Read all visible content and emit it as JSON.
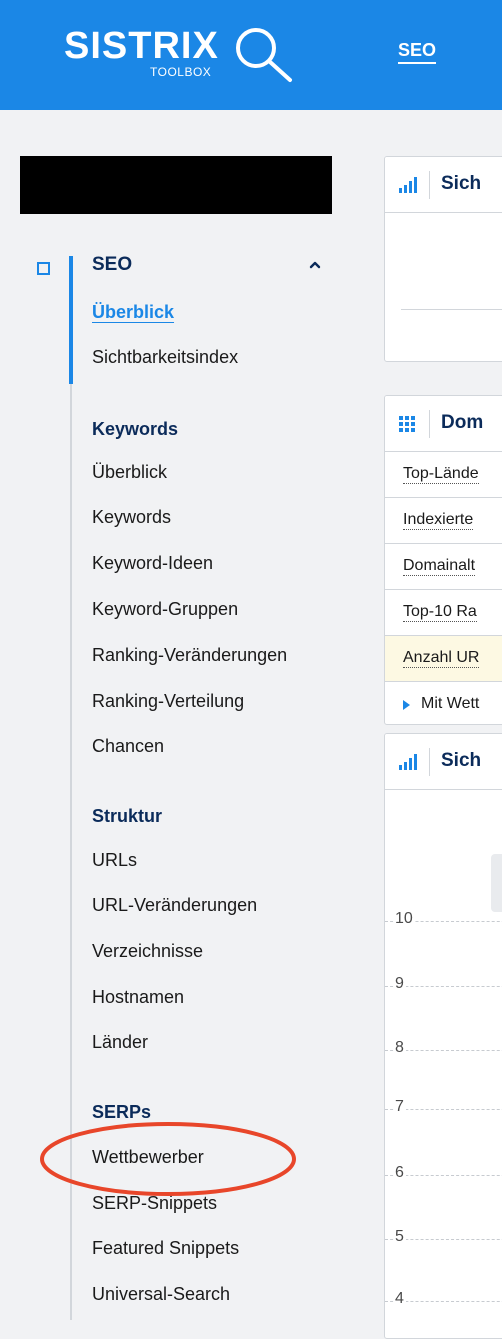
{
  "header": {
    "logo_text": "SISTRIX",
    "logo_sub": "TOOLBOX",
    "nav_seo": "SEO",
    "brand_color": "#1b87e6"
  },
  "sidebar": {
    "seo_title": "SEO",
    "seo_items": [
      "Überblick",
      "Sichtbarkeitsindex"
    ],
    "keywords_title": "Keywords",
    "keywords_items": [
      "Überblick",
      "Keywords",
      "Keyword-Ideen",
      "Keyword-Gruppen",
      "Ranking-Veränderungen",
      "Ranking-Verteilung",
      "Chancen"
    ],
    "struktur_title": "Struktur",
    "struktur_items": [
      "URLs",
      "URL-Veränderungen",
      "Verzeichnisse",
      "Hostnamen",
      "Länder"
    ],
    "serps_title": "SERPs",
    "serps_items": [
      "Wettbewerber",
      "SERP-Snippets",
      "Featured Snippets",
      "Universal-Search"
    ],
    "highlight_color": "#e8462a"
  },
  "main": {
    "panel1_title": "Sich",
    "panel2_title": "Dom",
    "panel2_rows": [
      "Top-Lände",
      "Indexierte",
      "Domainalt",
      "Top-10 Ra",
      "Anzahl UR"
    ],
    "panel2_more": "Mit Wett",
    "panel3_title": "Sich",
    "y_ticks": [
      "10",
      "9",
      "8",
      "7",
      "6",
      "5",
      "4"
    ]
  }
}
